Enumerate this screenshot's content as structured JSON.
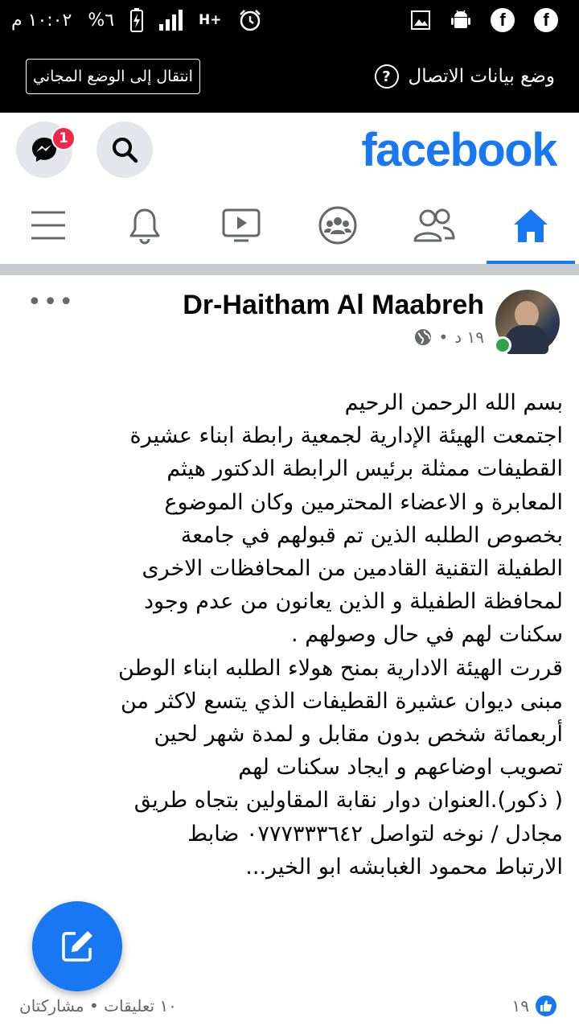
{
  "status_bar": {
    "time": "١٠:٠٢ م",
    "battery": "%٦",
    "network": "H+"
  },
  "data_bar": {
    "free_mode_button": "انتقال إلى الوضع المجاني",
    "title": "وضع بيانات الاتصال",
    "help": "?"
  },
  "header": {
    "logo": "facebook",
    "messenger_badge": "1"
  },
  "nav": {
    "items": [
      "home",
      "friends",
      "groups",
      "watch",
      "notifications",
      "menu"
    ]
  },
  "post": {
    "author": "Dr-Haitham Al Maabreh",
    "time": "١٩ د",
    "separator": "•",
    "lines": [
      "بسم الله الرحمن الرحيم",
      "اجتمعت  الهيئة الإدارية لجمعية رابطة ابناء عشيرة",
      "القطيفات ممثلة برئيس الرابطة الدكتور هيثم",
      "المعابرة و الاعضاء المحترمين وكان الموضوع",
      "بخصوص الطلبه الذين تم قبولهم في جامعة",
      "الطفيلة التقنية  القادمين من المحافظات الاخرى",
      "لمحافظة الطفيلة و الذين يعانون من عدم وجود",
      "سكنات لهم في حال وصولهم .",
      "قررت الهيئة الادارية بمنح هولاء الطلبه ابناء الوطن",
      "مبنى ديوان عشيرة القطيفات الذي يتسع لاكثر من",
      "أربعمائة شخص بدون مقابل و لمدة شهر لحين",
      "تصويب اوضاعهم و ايجاد سكنات لهم",
      "( ذكور).العنوان دوار نقابة المقاولين بتجاه طريق",
      "مجادل  / نوخه لتواصل ٠٧٧٧٣٣٣٦٤٢ ضابط",
      "الارتباط محمود الغبابشه ابو الخير..."
    ],
    "likes": "١٩",
    "comments_shares": "١٠ تعليقات • مشاركتان"
  },
  "colors": {
    "brand": "#1877f2",
    "online": "#31a24c",
    "badge": "#f02849"
  }
}
